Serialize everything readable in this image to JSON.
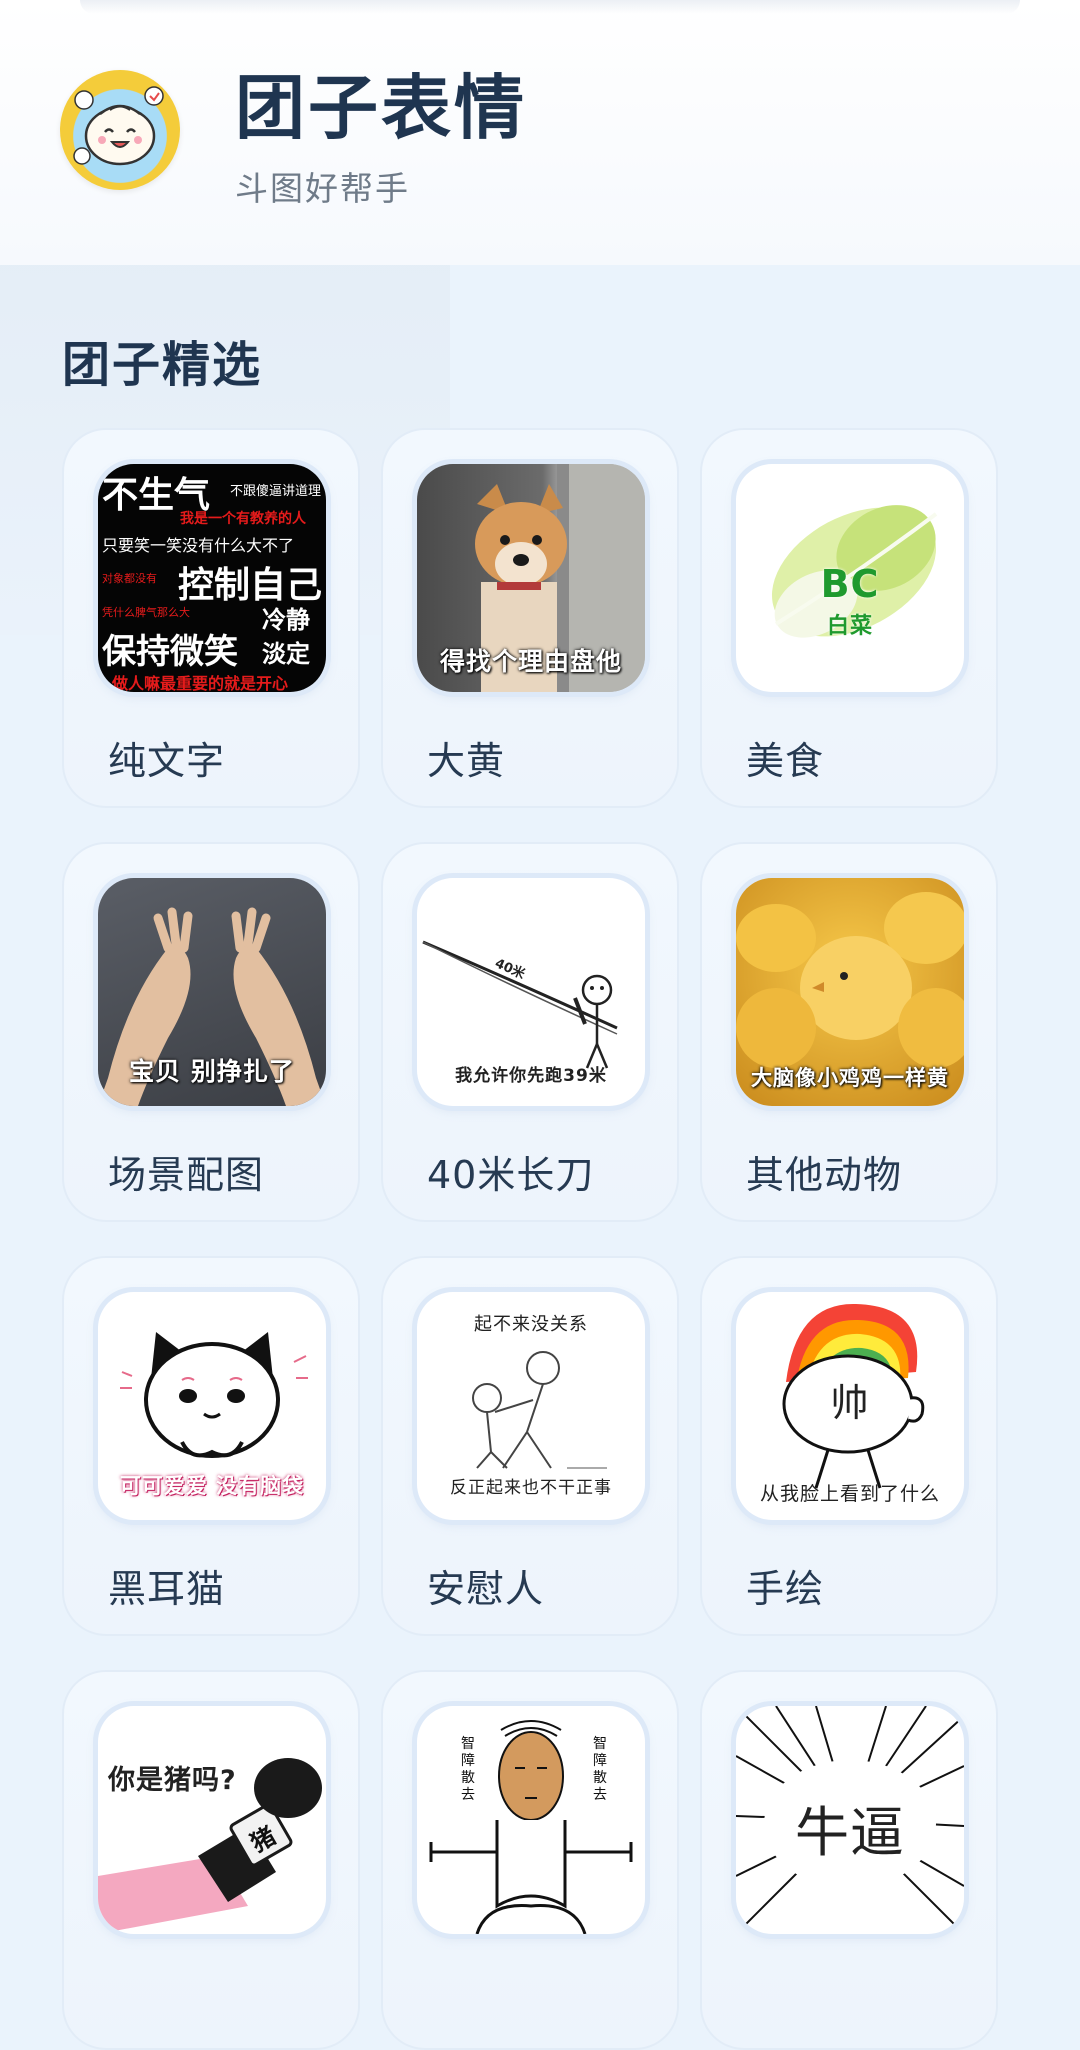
{
  "header": {
    "title": "团子表情",
    "subtitle": "斗图好帮手"
  },
  "section": {
    "title": "团子精选"
  },
  "categories": [
    {
      "label": "纯文字",
      "icon": "text-meme-thumbnail",
      "lines": [
        "不生气",
        "不跟傻逼讲道理",
        "我是一个有教养的人",
        "只要笑一笑没有什么大不了",
        "对象都没有",
        "控制自己",
        "凭什么脾气那么大",
        "冷静",
        "保持微笑",
        "淡定",
        "做人嘛最重要的就是开心"
      ]
    },
    {
      "label": "大黄",
      "icon": "dog-meme-thumbnail",
      "caption": "得找个理由盘他"
    },
    {
      "label": "美食",
      "icon": "cabbage-meme-thumbnail",
      "caption": "BC",
      "caption2": "白菜"
    },
    {
      "label": "场景配图",
      "icon": "hands-meme-thumbnail",
      "caption": "宝贝 别挣扎了"
    },
    {
      "label": "40米长刀",
      "icon": "long-sword-meme-thumbnail",
      "caption": "我允许你先跑39米",
      "tag": "40米"
    },
    {
      "label": "其他动物",
      "icon": "chicks-meme-thumbnail",
      "caption": "大脑像小鸡鸡一样黄"
    },
    {
      "label": "黑耳猫",
      "icon": "cat-meme-thumbnail",
      "caption": "可可爱爱 没有脑袋"
    },
    {
      "label": "安慰人",
      "icon": "comfort-meme-thumbnail",
      "caption": "起不来没关系",
      "caption2": "反正起来也不干正事"
    },
    {
      "label": "手绘",
      "icon": "rainbow-hair-meme-thumbnail",
      "caption": "帅",
      "caption2": "从我脸上看到了什么"
    },
    {
      "label": "",
      "icon": "microphone-meme-thumbnail",
      "caption": "你是猪吗?",
      "caption2": "猪"
    },
    {
      "label": "",
      "icon": "meditation-meme-thumbnail",
      "caption": "智障散去",
      "caption2": "智障散去"
    },
    {
      "label": "",
      "icon": "shock-lines-meme-thumbnail",
      "caption": "牛逼"
    }
  ],
  "colors": {
    "background": "#eaf3fc",
    "title": "#1f3550",
    "subtitle": "#6f7b89",
    "card_border": "#dde9f8"
  }
}
